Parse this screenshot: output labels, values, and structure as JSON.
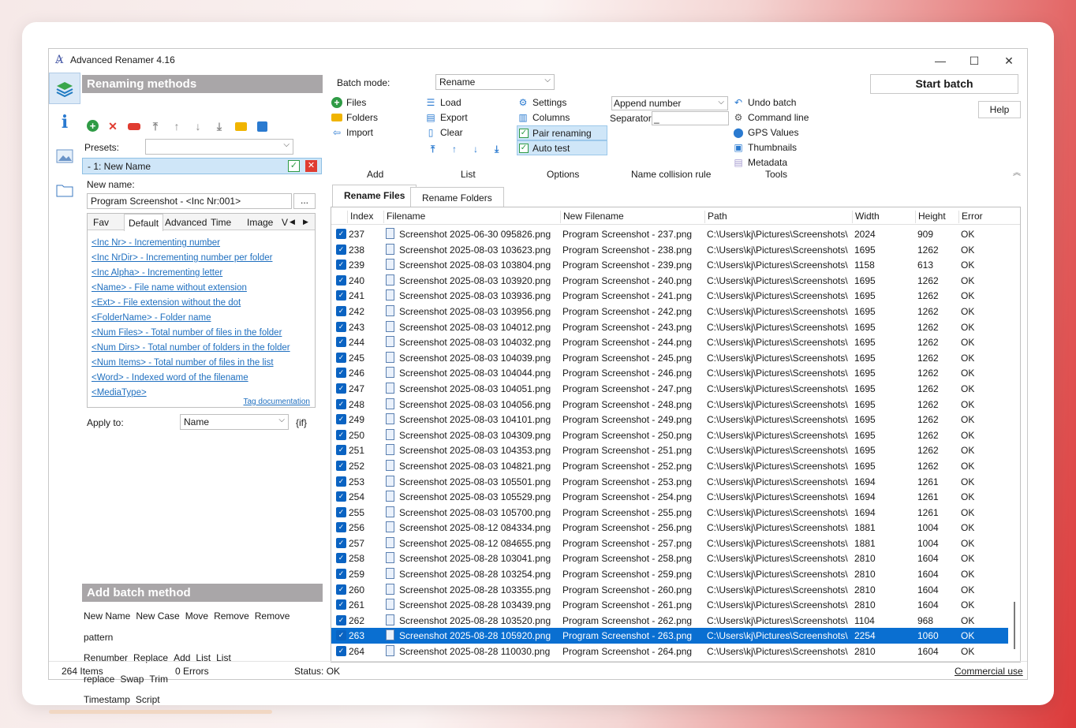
{
  "window": {
    "title": "Advanced Renamer 4.16",
    "minimize": "—",
    "maximize": "☐",
    "close": "✕"
  },
  "left": {
    "renaming_methods_title": "Renaming methods",
    "presets_label": "Presets:",
    "presets_value": "",
    "method_item": "-  1: New Name",
    "new_name_label": "New name:",
    "new_name_value": "Program Screenshot - <Inc Nr:001>",
    "ellipsis_btn": "...",
    "tag_tabs": [
      "Fav",
      "Default",
      "Advanced",
      "Time",
      "Image",
      "V"
    ],
    "tags": [
      "<Inc Nr> - Incrementing number",
      "<Inc NrDir> - Incrementing number per folder",
      "<Inc Alpha> - Incrementing letter",
      "<Name> - File name without extension",
      "<Ext> - File extension without the dot",
      "<FolderName> - Folder name",
      "<Num Files> - Total number of files in the folder",
      "<Num Dirs> - Total number of folders in the folder",
      "<Num Items> - Total number of files in the list",
      "<Word> - Indexed word of the filename",
      "<MediaType>"
    ],
    "tag_documentation": "Tag documentation",
    "apply_to_label": "Apply to:",
    "apply_to_value": "Name",
    "if_label": "{if}",
    "add_batch_title": "Add batch method",
    "batch_methods": [
      "New Name",
      "New Case",
      "Move",
      "Remove",
      "Remove pattern",
      "Renumber",
      "Replace",
      "Add",
      "List",
      "List replace",
      "Swap",
      "Trim",
      "Timestamp",
      "Script"
    ]
  },
  "top": {
    "batch_mode_label": "Batch mode:",
    "batch_mode_value": "Rename",
    "start_batch": "Start batch",
    "help": "Help",
    "add": {
      "files": "Files",
      "folders": "Folders",
      "import": "Import"
    },
    "list": {
      "load": "Load",
      "export": "Export",
      "clear": "Clear"
    },
    "options": {
      "settings": "Settings",
      "columns": "Columns",
      "pair_renaming": "Pair renaming",
      "auto_test": "Auto test"
    },
    "collision": {
      "value": "Append number",
      "separator_label": "Separator:",
      "separator_value": "_"
    },
    "tools": {
      "undo_batch": "Undo batch",
      "command_line": "Command line",
      "gps_values": "GPS Values",
      "thumbnails": "Thumbnails",
      "metadata": "Metadata"
    },
    "groups": {
      "add": "Add",
      "list": "List",
      "options": "Options",
      "collision": "Name collision rule",
      "tools": "Tools"
    }
  },
  "tabs": {
    "rename_files": "Rename Files",
    "rename_folders": "Rename Folders"
  },
  "columns": {
    "index": "Index",
    "filename": "Filename",
    "new_filename": "New Filename",
    "path": "Path",
    "width": "Width",
    "height": "Height",
    "error": "Error"
  },
  "rows": [
    {
      "i": "237",
      "f": "Screenshot 2025-06-30 095826.png",
      "n": "Program Screenshot - 237.png",
      "w": "2024",
      "h": "909"
    },
    {
      "i": "238",
      "f": "Screenshot 2025-08-03 103623.png",
      "n": "Program Screenshot - 238.png",
      "w": "1695",
      "h": "1262"
    },
    {
      "i": "239",
      "f": "Screenshot 2025-08-03 103804.png",
      "n": "Program Screenshot - 239.png",
      "w": "1158",
      "h": "613"
    },
    {
      "i": "240",
      "f": "Screenshot 2025-08-03 103920.png",
      "n": "Program Screenshot - 240.png",
      "w": "1695",
      "h": "1262"
    },
    {
      "i": "241",
      "f": "Screenshot 2025-08-03 103936.png",
      "n": "Program Screenshot - 241.png",
      "w": "1695",
      "h": "1262"
    },
    {
      "i": "242",
      "f": "Screenshot 2025-08-03 103956.png",
      "n": "Program Screenshot - 242.png",
      "w": "1695",
      "h": "1262"
    },
    {
      "i": "243",
      "f": "Screenshot 2025-08-03 104012.png",
      "n": "Program Screenshot - 243.png",
      "w": "1695",
      "h": "1262"
    },
    {
      "i": "244",
      "f": "Screenshot 2025-08-03 104032.png",
      "n": "Program Screenshot - 244.png",
      "w": "1695",
      "h": "1262"
    },
    {
      "i": "245",
      "f": "Screenshot 2025-08-03 104039.png",
      "n": "Program Screenshot - 245.png",
      "w": "1695",
      "h": "1262"
    },
    {
      "i": "246",
      "f": "Screenshot 2025-08-03 104044.png",
      "n": "Program Screenshot - 246.png",
      "w": "1695",
      "h": "1262"
    },
    {
      "i": "247",
      "f": "Screenshot 2025-08-03 104051.png",
      "n": "Program Screenshot - 247.png",
      "w": "1695",
      "h": "1262"
    },
    {
      "i": "248",
      "f": "Screenshot 2025-08-03 104056.png",
      "n": "Program Screenshot - 248.png",
      "w": "1695",
      "h": "1262"
    },
    {
      "i": "249",
      "f": "Screenshot 2025-08-03 104101.png",
      "n": "Program Screenshot - 249.png",
      "w": "1695",
      "h": "1262"
    },
    {
      "i": "250",
      "f": "Screenshot 2025-08-03 104309.png",
      "n": "Program Screenshot - 250.png",
      "w": "1695",
      "h": "1262"
    },
    {
      "i": "251",
      "f": "Screenshot 2025-08-03 104353.png",
      "n": "Program Screenshot - 251.png",
      "w": "1695",
      "h": "1262"
    },
    {
      "i": "252",
      "f": "Screenshot 2025-08-03 104821.png",
      "n": "Program Screenshot - 252.png",
      "w": "1695",
      "h": "1262"
    },
    {
      "i": "253",
      "f": "Screenshot 2025-08-03 105501.png",
      "n": "Program Screenshot - 253.png",
      "w": "1694",
      "h": "1261"
    },
    {
      "i": "254",
      "f": "Screenshot 2025-08-03 105529.png",
      "n": "Program Screenshot - 254.png",
      "w": "1694",
      "h": "1261"
    },
    {
      "i": "255",
      "f": "Screenshot 2025-08-03 105700.png",
      "n": "Program Screenshot - 255.png",
      "w": "1694",
      "h": "1261"
    },
    {
      "i": "256",
      "f": "Screenshot 2025-08-12 084334.png",
      "n": "Program Screenshot - 256.png",
      "w": "1881",
      "h": "1004"
    },
    {
      "i": "257",
      "f": "Screenshot 2025-08-12 084655.png",
      "n": "Program Screenshot - 257.png",
      "w": "1881",
      "h": "1004"
    },
    {
      "i": "258",
      "f": "Screenshot 2025-08-28 103041.png",
      "n": "Program Screenshot - 258.png",
      "w": "2810",
      "h": "1604"
    },
    {
      "i": "259",
      "f": "Screenshot 2025-08-28 103254.png",
      "n": "Program Screenshot - 259.png",
      "w": "2810",
      "h": "1604"
    },
    {
      "i": "260",
      "f": "Screenshot 2025-08-28 103355.png",
      "n": "Program Screenshot - 260.png",
      "w": "2810",
      "h": "1604"
    },
    {
      "i": "261",
      "f": "Screenshot 2025-08-28 103439.png",
      "n": "Program Screenshot - 261.png",
      "w": "2810",
      "h": "1604"
    },
    {
      "i": "262",
      "f": "Screenshot 2025-08-28 103520.png",
      "n": "Program Screenshot - 262.png",
      "w": "1104",
      "h": "968"
    },
    {
      "i": "263",
      "f": "Screenshot 2025-08-28 105920.png",
      "n": "Program Screenshot - 263.png",
      "w": "2254",
      "h": "1060",
      "sel": true
    },
    {
      "i": "264",
      "f": "Screenshot 2025-08-28 110030.png",
      "n": "Program Screenshot - 264.png",
      "w": "2810",
      "h": "1604"
    }
  ],
  "row_path": "C:\\Users\\kj\\Pictures\\Screenshots\\",
  "row_error": "OK",
  "status": {
    "items": "264 Items",
    "errors": "0 Errors",
    "status": "Status: OK",
    "commercial": "Commercial use"
  },
  "colors": {
    "accent": "#0a6fd1",
    "header_bg": "#a9a6a8",
    "highlight": "#cfe6f8"
  }
}
